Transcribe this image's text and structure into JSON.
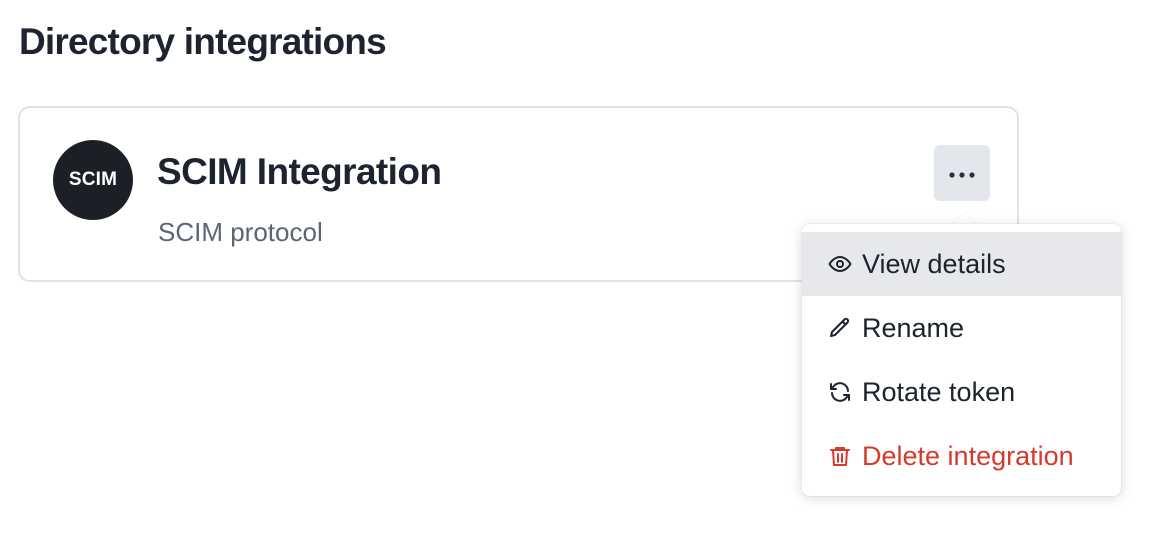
{
  "page": {
    "title": "Directory integrations"
  },
  "integration": {
    "logo_text": "SCIM",
    "name": "SCIM Integration",
    "protocol": "SCIM protocol",
    "more_icon": "ellipsis-horizontal-icon"
  },
  "menu": {
    "items": [
      {
        "label": "View details",
        "icon": "eye-icon",
        "active": true
      },
      {
        "label": "Rename",
        "icon": "pencil-icon"
      },
      {
        "label": "Rotate token",
        "icon": "refresh-icon"
      },
      {
        "label": "Delete integration",
        "icon": "trash-icon",
        "danger": true
      }
    ]
  },
  "colors": {
    "text_primary": "#1d2330",
    "text_secondary": "#5a6578",
    "danger": "#d63a2b",
    "card_border": "#dde2e8",
    "active_item_bg": "#e6e8eb",
    "logo_bg": "#1d1f26"
  }
}
